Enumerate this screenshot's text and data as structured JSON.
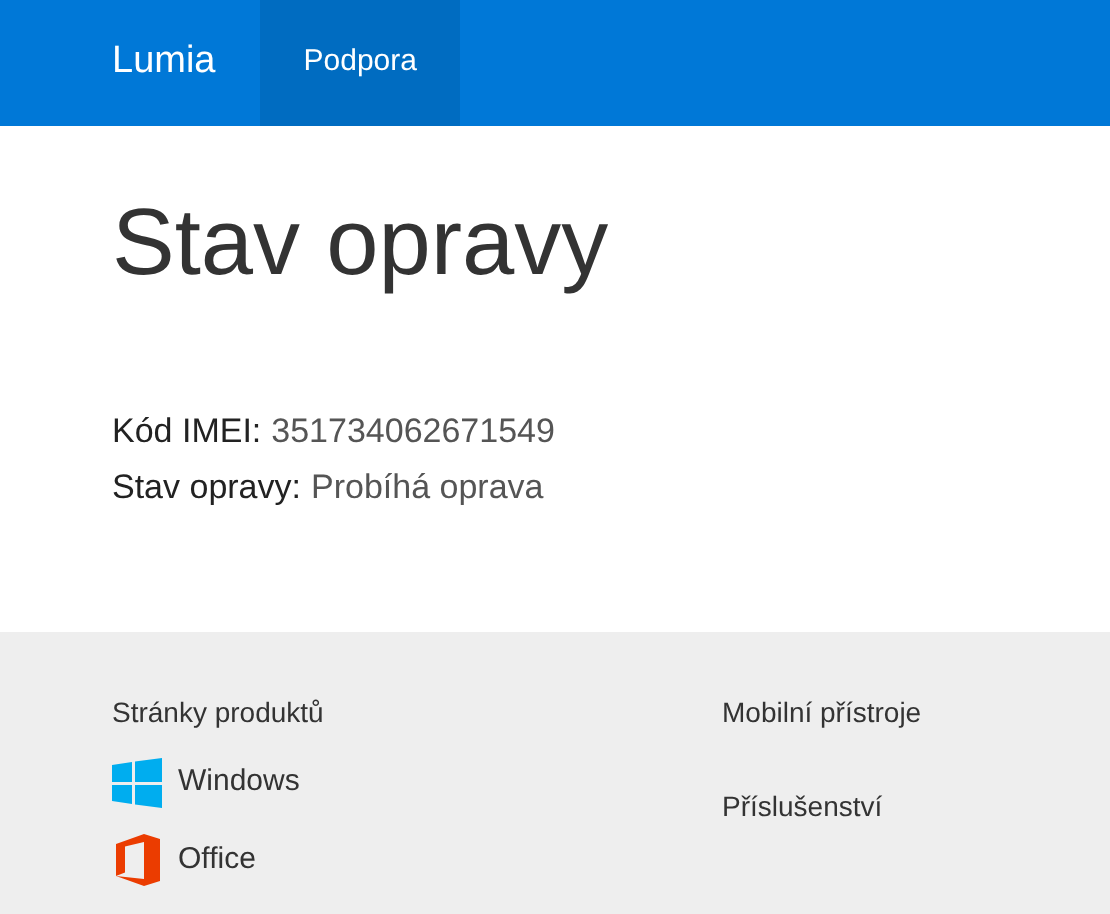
{
  "header": {
    "brand": "Lumia",
    "tabs": [
      {
        "label": "Podpora",
        "selected": true
      }
    ]
  },
  "page": {
    "title": "Stav opravy",
    "fields": [
      {
        "label": "Kód IMEI:",
        "value": "351734062671549"
      },
      {
        "label": "Stav opravy:",
        "value": "Probíhá oprava"
      }
    ]
  },
  "footer": {
    "heading": "Stránky produktů",
    "products": [
      {
        "kind": "windows",
        "label": "Windows"
      },
      {
        "kind": "office",
        "label": "Office"
      }
    ],
    "links": [
      "Mobilní přístroje",
      "Příslušenství"
    ]
  }
}
